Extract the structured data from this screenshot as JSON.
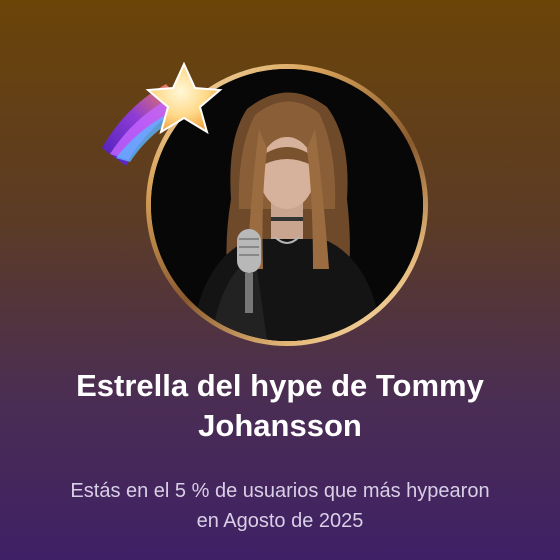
{
  "header": {
    "title": "Estrella del hype de Tommy Johansson",
    "subtitle": "Estás en el 5 % de usuarios que más hypearon en Agosto de 2025"
  },
  "icons": {
    "badge": "shooting-star-icon",
    "portrait": "artist-avatar"
  },
  "colors": {
    "background_top": "#6b4408",
    "background_bottom": "#3f2066",
    "title": "#ffffff",
    "subtitle": "#d9cfe6",
    "ring": "#d9a35b"
  }
}
